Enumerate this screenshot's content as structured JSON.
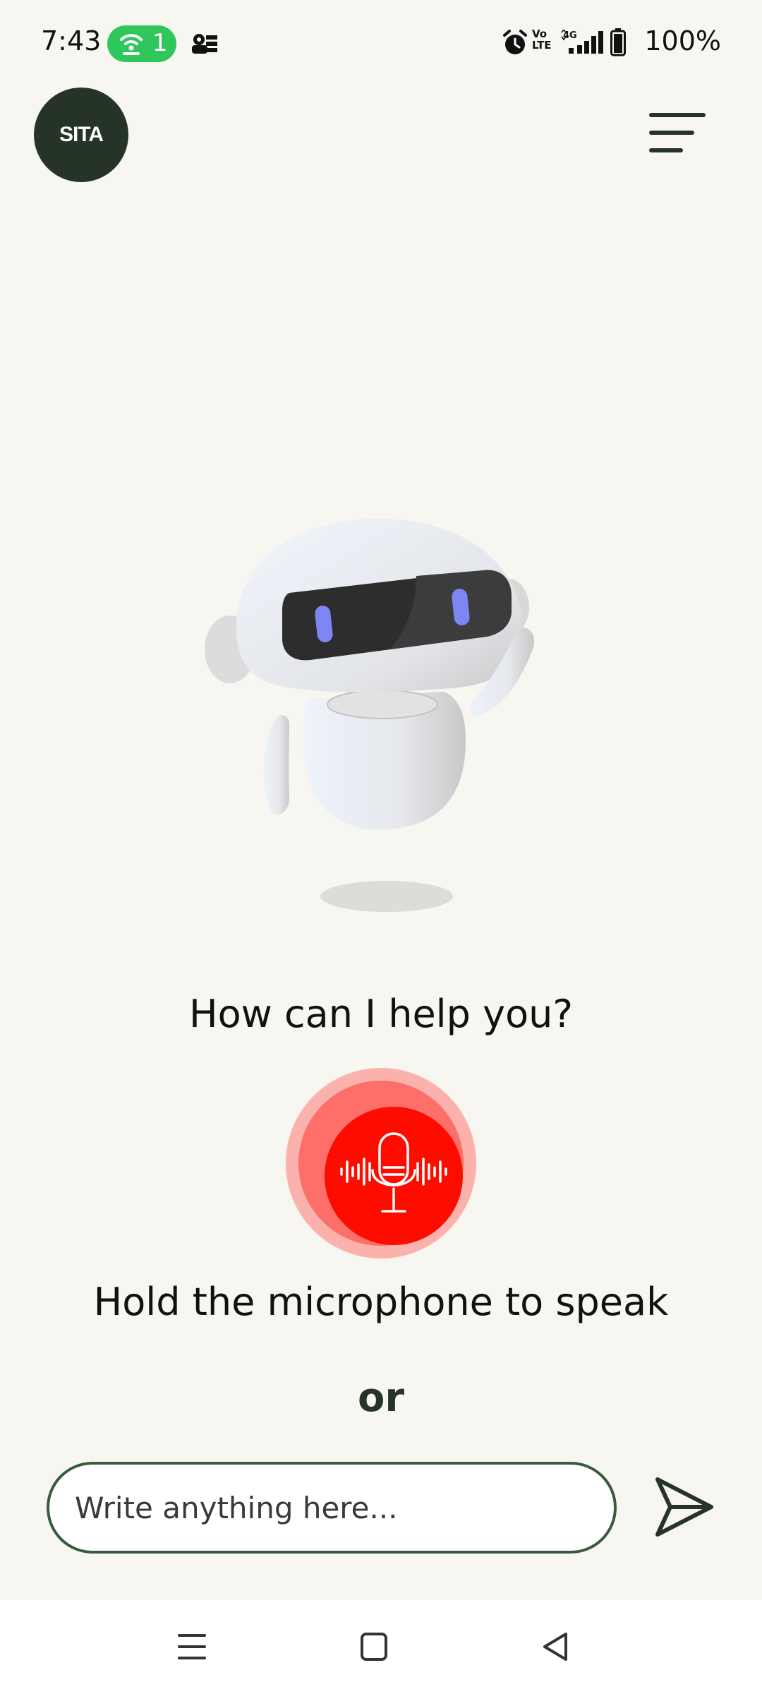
{
  "status_bar": {
    "time": "7:43",
    "hotspot_count": "1",
    "battery": "100%",
    "network": "4G",
    "volte": "Vo\nLTE"
  },
  "header": {
    "logo_text": "SITA",
    "menu_icon": "menu-lines-icon"
  },
  "assistant": {
    "prompt": "How can I help you?",
    "mic_hint": "Hold the microphone to speak",
    "or_label": "or"
  },
  "composer": {
    "placeholder": "Write anything here...",
    "send_icon": "send-icon"
  },
  "colors": {
    "background": "#f8f6f0",
    "brand_dark": "#263427",
    "mic_red": "#fd0c00",
    "hotspot_green": "#2fc65b"
  },
  "nav": {
    "recent_icon": "recent-apps-icon",
    "home_icon": "home-icon",
    "back_icon": "back-icon"
  }
}
